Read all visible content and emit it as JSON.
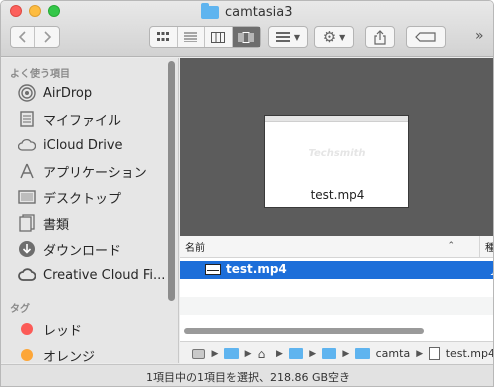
{
  "window": {
    "title": "camtasia3"
  },
  "toolbar": {
    "back_icon": "chevron-left-icon",
    "forward_icon": "chevron-right-icon",
    "view_icons": [
      "icon-view",
      "list-view",
      "column-view",
      "coverflow-view"
    ],
    "arrange_icon": "grid-arrange-icon",
    "action_icon": "gear-icon",
    "share_icon": "share-icon",
    "tag_icon": "tag-icon",
    "overflow_label": "»"
  },
  "sidebar": {
    "favorites_heading": "よく使う項目",
    "favorites": [
      {
        "label": "AirDrop",
        "icon": "airdrop-icon"
      },
      {
        "label": "マイファイル",
        "icon": "all-files-icon"
      },
      {
        "label": "iCloud Drive",
        "icon": "cloud-icon"
      },
      {
        "label": "アプリケーション",
        "icon": "applications-icon"
      },
      {
        "label": "デスクトップ",
        "icon": "desktop-icon"
      },
      {
        "label": "書類",
        "icon": "documents-icon"
      },
      {
        "label": "ダウンロード",
        "icon": "downloads-icon"
      },
      {
        "label": "Creative Cloud Fi...",
        "icon": "creative-cloud-icon"
      }
    ],
    "tags_heading": "タグ",
    "tags": [
      {
        "label": "レッド",
        "color": "#fc5b57"
      },
      {
        "label": "オレンジ",
        "color": "#fda638"
      }
    ]
  },
  "preview": {
    "caption": "test.mp4",
    "watermark": "Techsmith"
  },
  "list": {
    "column_name": "名前",
    "column_kind": "種",
    "rows": [
      {
        "name": "test.mp4",
        "kind": "ム",
        "icon": "movie-icon",
        "selected": true
      }
    ]
  },
  "pathbar": {
    "items": [
      {
        "icon": "disk-icon",
        "label": ""
      },
      {
        "icon": "folder-icon",
        "label": ""
      },
      {
        "icon": "home-icon",
        "label": ""
      },
      {
        "icon": "folder-icon",
        "label": ""
      },
      {
        "icon": "folder-icon",
        "label": ""
      },
      {
        "icon": "folder-icon",
        "label": "camta"
      },
      {
        "icon": "file-icon",
        "label": "test.mp4"
      }
    ]
  },
  "status": {
    "text": "1項目中の1項目を選択、218.86 GB空き"
  },
  "colors": {
    "selection": "#1c6ed9",
    "folder": "#5fb4ef",
    "preview_bg": "#5c5c5c"
  }
}
